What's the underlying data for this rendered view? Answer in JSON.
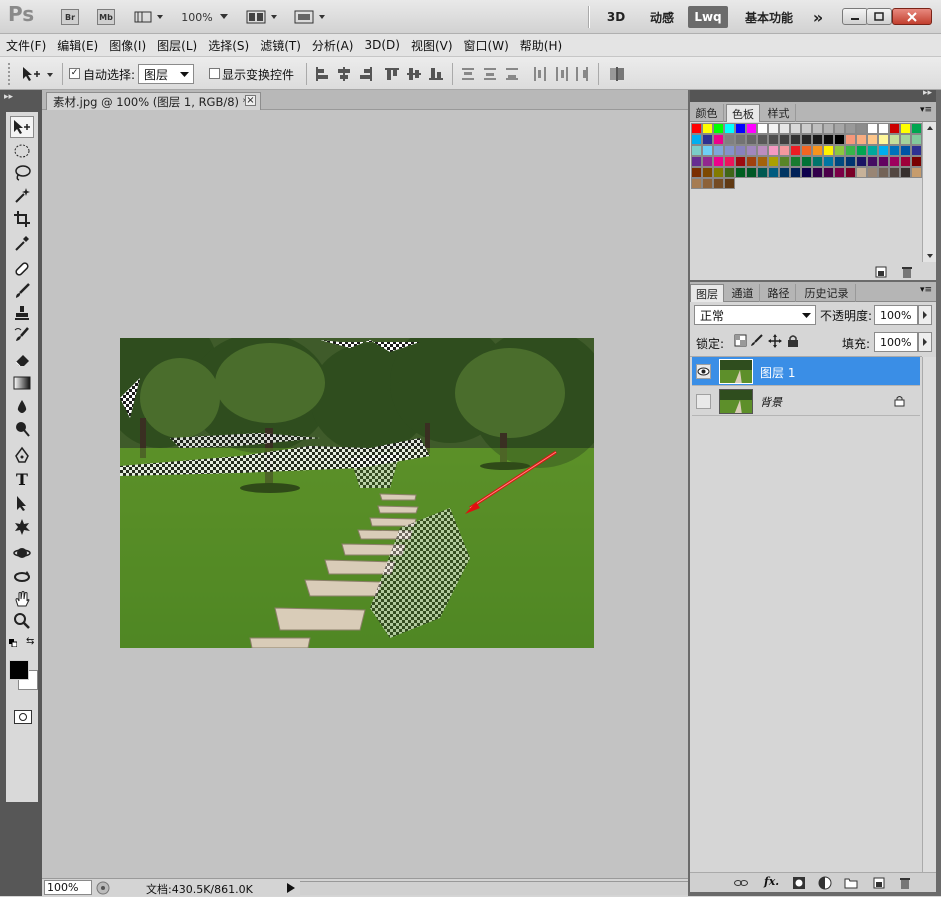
{
  "app": {
    "logo": "Ps",
    "bridge_label": "Br",
    "minibridge_label": "Mb",
    "zoom_level": "100%",
    "workspaces": [
      "3D",
      "动感",
      "Lwq",
      "基本功能"
    ],
    "more_label": "»"
  },
  "menu": [
    "文件(F)",
    "编辑(E)",
    "图像(I)",
    "图层(L)",
    "选择(S)",
    "滤镜(T)",
    "分析(A)",
    "3D(D)",
    "视图(V)",
    "窗口(W)",
    "帮助(H)"
  ],
  "options": {
    "auto_select_label": "自动选择:",
    "auto_select_checked": true,
    "auto_select_value": "图层",
    "show_transform_label": "显示变换控件",
    "show_transform_checked": false
  },
  "document": {
    "tab_title": "素材.jpg @ 100% (图层 1, RGB/8) *",
    "close_glyph": "×",
    "status_zoom": "100%",
    "status_doc": "文档:430.5K/861.0K"
  },
  "panels": {
    "swatch_tabs": [
      "颜色",
      "色板",
      "样式"
    ],
    "swatch_active": "色板",
    "layer_tabs": [
      "图层",
      "通道",
      "路径",
      "历史记录"
    ],
    "layer_active": "图层",
    "blend_mode": "正常",
    "opacity_label": "不透明度:",
    "opacity_value": "100%",
    "lock_label": "锁定:",
    "fill_label": "填充:",
    "fill_value": "100%",
    "layers": [
      {
        "name": "图层 1",
        "selected": true,
        "visible": true,
        "locked": false
      },
      {
        "name": "背景",
        "selected": false,
        "visible": false,
        "locked": true
      }
    ]
  },
  "colors": {
    "selection": "#3a8ee6",
    "arrow": "#e01010",
    "toolbox_bg": "#575757"
  },
  "swatch_rows": [
    [
      "#ff0000",
      "#ffff00",
      "#00ff00",
      "#00ffff",
      "#0000ff",
      "#ff00ff",
      "#ffffff",
      "#f2f2f2",
      "#e6e6e6",
      "#d9d9d9",
      "#cccccc",
      "#bfbfbf",
      "#b3b3b3",
      "#a6a6a6",
      "#999999",
      "#8c8c8c",
      "#ffffff",
      "#ffffff",
      "#cc0000",
      "#ffff00",
      "#00a650"
    ],
    [
      "#00aeef",
      "#2e3192",
      "#ec008c",
      "#808080",
      "#737373",
      "#666666",
      "#595959",
      "#4d4d4d",
      "#404040",
      "#333333",
      "#262626",
      "#1a1a1a",
      "#0d0d0d",
      "#000000",
      "#f7977a",
      "#f9ad81",
      "#fdc68a",
      "#fff79a",
      "#c4df9b",
      "#a3d39c",
      "#82ca9d"
    ],
    [
      "#7bcdc8",
      "#6ecff6",
      "#7ea7d8",
      "#8493ca",
      "#8882be",
      "#a187be",
      "#bc8dbf",
      "#f49ac2",
      "#f6989d",
      "#ed1c24",
      "#f26522",
      "#f7941d",
      "#fff200",
      "#8dc73f",
      "#39b54a",
      "#00a651",
      "#00a99d",
      "#00aeef",
      "#0072bc",
      "#0054a6",
      "#2e3192"
    ],
    [
      "#662d91",
      "#92278f",
      "#ec008c",
      "#ed145b",
      "#9e0b0f",
      "#a0410d",
      "#a3620a",
      "#aba000",
      "#598527",
      "#197b30",
      "#007236",
      "#00746b",
      "#0076a3",
      "#004a80",
      "#003471",
      "#1b1464",
      "#440e62",
      "#630460",
      "#9e005d",
      "#9e0039",
      "#790000"
    ],
    [
      "#7b2e00",
      "#7d4900",
      "#827b00",
      "#406618",
      "#005e20",
      "#005826",
      "#005952",
      "#005b7f",
      "#003663",
      "#002157",
      "#0d004c",
      "#32004b",
      "#4b0049",
      "#7b0046",
      "#7a0026",
      "#c7b299",
      "#998675",
      "#736357",
      "#534741",
      "#362f2d",
      "#c69c6d"
    ],
    [
      "#a67c52",
      "#8c6239",
      "#754c24",
      "#603913"
    ]
  ]
}
